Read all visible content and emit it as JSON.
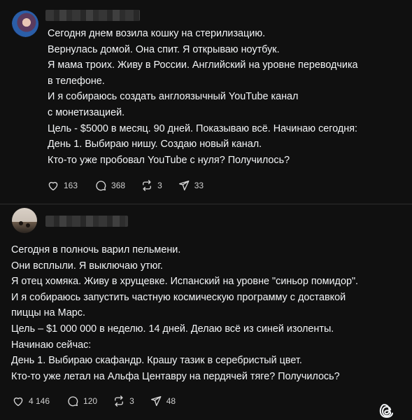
{
  "posts": [
    {
      "lines": [
        "Сегодня днем возила кошку на стерилизацию.",
        "Вернулась домой. Она спит. Я открываю ноутбук.",
        "Я мама троих. Живу в России. Английский на уровне переводчика",
        "в телефоне.",
        "И я собираюсь создать англоязычный YouTube канал",
        "с монетизацией.",
        "Цель - $5000 в месяц. 90 дней. Показываю всё. Начинаю сегодня:",
        "День 1. Выбираю нишу. Создаю новый канал.",
        "Кто-то уже пробовал YouTube с нуля? Получилось?"
      ],
      "stats": {
        "likes": "163",
        "comments": "368",
        "reposts": "3",
        "shares": "33"
      }
    },
    {
      "lines": [
        "Сегодня в полночь варил пельмени.",
        "Они всплыли. Я выключаю утюг.",
        "Я отец хомяка. Живу в хрущевке. Испанский на уровне \"синьор помидор\".",
        "И я собираюсь запустить частную космическую программу с доставкой",
        "пиццы на Марс.",
        "Цель – $1 000 000 в неделю. 14 дней. Делаю всё из синей изоленты.",
        "Начинаю сейчас:",
        "День 1. Выбираю скафандр. Крашу тазик в серебристый цвет.",
        "Кто-то уже летал на Альфа Центавру на пердячей тяге? Получилось?"
      ],
      "stats": {
        "likes": "4 146",
        "comments": "120",
        "reposts": "3",
        "shares": "48"
      }
    }
  ],
  "icons": [
    "heart-icon",
    "comment-icon",
    "repost-icon",
    "share-icon",
    "threads-logo-icon"
  ],
  "colors": {
    "background": "#101010",
    "text": "#f3f5f7",
    "muted": "#cfcfcf",
    "divider": "#2d2d2d"
  }
}
